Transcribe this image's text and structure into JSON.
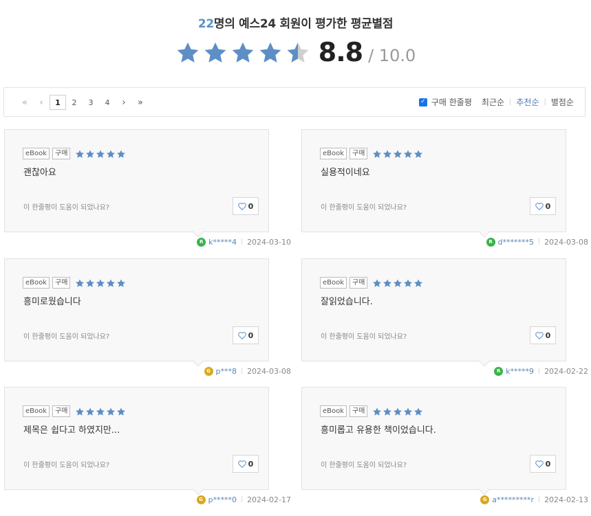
{
  "summary": {
    "count": "22",
    "title_suffix": "명의 예스24 회원이 평가한 평균별점",
    "score": "8.8",
    "score_max": "/ 10.0",
    "stars_filled": 4.5,
    "star_color": "#5d8ec6"
  },
  "pager": {
    "pages": [
      "1",
      "2",
      "3",
      "4"
    ],
    "current": "1",
    "first": "«",
    "prev": "‹",
    "next": "›",
    "last": "»"
  },
  "sort": {
    "filter_label": "구매 한줄평",
    "options": [
      "최근순",
      "추천순",
      "별점순"
    ],
    "active": "추천순",
    "separator": "|"
  },
  "labels": {
    "helpful_question": "이 한줄평이 도움이 되었나요?"
  },
  "reviews": [
    {
      "format": "eBook",
      "purchase": "구매",
      "rating": 5,
      "text": "괜찮아요",
      "likes": "0",
      "grade": "R",
      "grade_color": "#38b34a",
      "user": "k*****4",
      "date": "2024-03-10"
    },
    {
      "format": "eBook",
      "purchase": "구매",
      "rating": 5,
      "text": "실용적이네요",
      "likes": "0",
      "grade": "R",
      "grade_color": "#38b34a",
      "user": "d*******5",
      "date": "2024-03-08"
    },
    {
      "format": "eBook",
      "purchase": "구매",
      "rating": 5,
      "text": "흥미로웠습니다",
      "likes": "0",
      "grade": "G",
      "grade_color": "#d9a81e",
      "user": "p***8",
      "date": "2024-03-08"
    },
    {
      "format": "eBook",
      "purchase": "구매",
      "rating": 5,
      "text": "잘읽었습니다.",
      "likes": "0",
      "grade": "R",
      "grade_color": "#38b34a",
      "user": "k*****9",
      "date": "2024-02-22"
    },
    {
      "format": "eBook",
      "purchase": "구매",
      "rating": 5,
      "text": "제목은 쉽다고 하였지만...",
      "likes": "0",
      "grade": "G",
      "grade_color": "#d9a81e",
      "user": "p*****0",
      "date": "2024-02-17"
    },
    {
      "format": "eBook",
      "purchase": "구매",
      "rating": 5,
      "text": "흥미롭고 유용한 책이었습니다.",
      "likes": "0",
      "grade": "G",
      "grade_color": "#d9a81e",
      "user": "a*********r",
      "date": "2024-02-13"
    }
  ]
}
